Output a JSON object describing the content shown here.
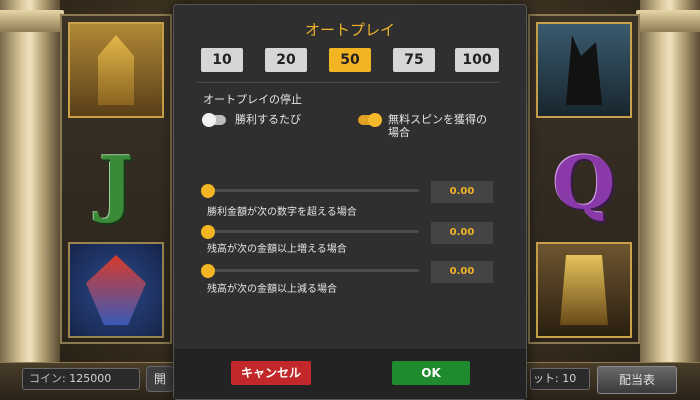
{
  "background": {
    "coin_label": "コイン:",
    "coin_value": "125000",
    "side_button": "開",
    "bet_text": "ット: 10",
    "paytable_label": "配当表",
    "symbols": [
      "sphinx",
      "J",
      "bird",
      "anubis",
      "Q",
      "pharaoh"
    ]
  },
  "modal": {
    "title": "オートプレイ",
    "spin_options": [
      "10",
      "20",
      "50",
      "75",
      "100"
    ],
    "selected_option": "50",
    "stop_section_title": "オートプレイの停止",
    "toggles": {
      "win": {
        "label": "勝利するたび",
        "on": false
      },
      "free_spin": {
        "label_line1": "無料スピンを獲得の",
        "label_line2": "場合",
        "on": true
      }
    },
    "sliders": [
      {
        "label": "勝利金額が次の数字を超える場合",
        "value": "0.00"
      },
      {
        "label": "残高が次の金額以上増える場合",
        "value": "0.00"
      },
      {
        "label": "残高が次の金額以上減る場合",
        "value": "0.00"
      }
    ],
    "cancel_label": "キャンセル",
    "ok_label": "OK"
  },
  "colors": {
    "accent": "#f3b423",
    "cancel": "#c2282a",
    "ok": "#1f8a2e"
  }
}
